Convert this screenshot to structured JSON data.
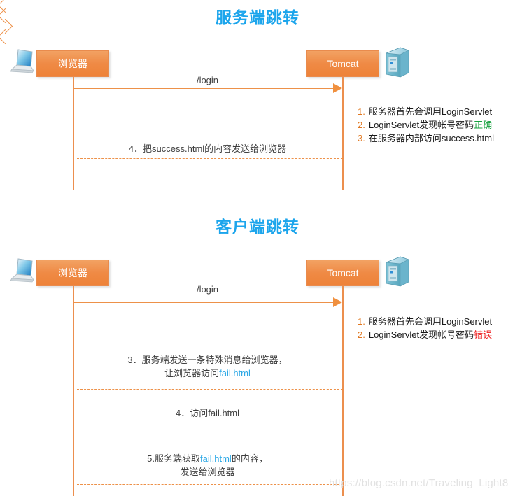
{
  "diagrams": [
    {
      "title": "服务端跳转",
      "participants": {
        "client": "浏览器",
        "server": "Tomcat"
      },
      "messages": [
        {
          "label": "/login"
        },
        {
          "label": "4．把success.html的内容发送给浏览器"
        }
      ],
      "notes": [
        {
          "num": "1.",
          "text_before": "服务器首先会调用LoginServlet",
          "highlight": "",
          "text_after": ""
        },
        {
          "num": "2.",
          "text_before": "LoginServlet发现帐号密码",
          "highlight": "正确",
          "text_after": ""
        },
        {
          "num": "3.",
          "text_before": "在服务器内部访问success.html",
          "highlight": "",
          "text_after": ""
        }
      ]
    },
    {
      "title": "客户端跳转",
      "participants": {
        "client": "浏览器",
        "server": "Tomcat"
      },
      "messages": [
        {
          "label": "/login"
        },
        {
          "line1_before": "3．服务端发送一条特殊消息给浏览器，",
          "line2_before": "让浏览器访问",
          "line2_link": "fail.html"
        },
        {
          "label": "4．访问fail.html"
        },
        {
          "line1_before": "5.服务端获取",
          "line1_link": "fail.html",
          "line1_after": "的内容，",
          "line2_before": "发送给浏览器"
        }
      ],
      "notes": [
        {
          "num": "1.",
          "text_before": "服务器首先会调用LoginServlet",
          "highlight": "",
          "text_after": ""
        },
        {
          "num": "2.",
          "text_before": "LoginServlet发现帐号密码",
          "highlight": "错误",
          "text_after": ""
        }
      ]
    }
  ],
  "colors": {
    "title": "#1ca5ec",
    "accent_orange": "#ee8238",
    "line_orange": "#ed9149",
    "correct_green": "#14a03c",
    "error_red": "#ee1c1c",
    "link_blue": "#2ea9e6"
  },
  "watermark": "https://blog.csdn.net/Traveling_Light8"
}
